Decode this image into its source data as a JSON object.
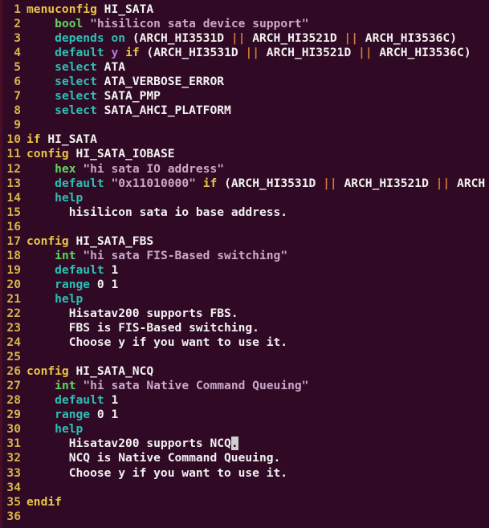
{
  "terminal": {
    "title": "Kconfig editor",
    "background_color": "#300a24",
    "gutter_color": "#d7b44a",
    "cursor": {
      "line": 31,
      "column": 27,
      "char": "."
    }
  },
  "colors": {
    "keyword": "#e8c547",
    "type": "#5fd75f",
    "attribute": "#2bbfb5",
    "string": "#c9a8c9",
    "plain": "#f2f2f2",
    "operator": "#d07b3a",
    "boolean": "#b07be0",
    "line_number": "#d7b44a",
    "background": "#300a24"
  },
  "lines": [
    {
      "n": "1",
      "tokens": [
        {
          "t": "key",
          "v": "menuconfig"
        },
        {
          "t": "plain",
          "v": " HI_SATA"
        }
      ]
    },
    {
      "n": "2",
      "tokens": [
        {
          "t": "plain",
          "v": "    "
        },
        {
          "t": "type",
          "v": "bool"
        },
        {
          "t": "plain",
          "v": " "
        },
        {
          "t": "str",
          "v": "\"hisilicon sata device support\""
        }
      ]
    },
    {
      "n": "3",
      "tokens": [
        {
          "t": "plain",
          "v": "    "
        },
        {
          "t": "attr",
          "v": "depends on"
        },
        {
          "t": "plain",
          "v": " (ARCH_HI3531D "
        },
        {
          "t": "op",
          "v": "||"
        },
        {
          "t": "plain",
          "v": " ARCH_HI3521D "
        },
        {
          "t": "op",
          "v": "||"
        },
        {
          "t": "plain",
          "v": " ARCH_HI3536C)"
        }
      ]
    },
    {
      "n": "4",
      "tokens": [
        {
          "t": "plain",
          "v": "    "
        },
        {
          "t": "attr",
          "v": "default"
        },
        {
          "t": "plain",
          "v": " "
        },
        {
          "t": "bool",
          "v": "y"
        },
        {
          "t": "plain",
          "v": " "
        },
        {
          "t": "key",
          "v": "if"
        },
        {
          "t": "plain",
          "v": " (ARCH_HI3531D "
        },
        {
          "t": "op",
          "v": "||"
        },
        {
          "t": "plain",
          "v": " ARCH_HI3521D "
        },
        {
          "t": "op",
          "v": "||"
        },
        {
          "t": "plain",
          "v": " ARCH_HI3536C)"
        }
      ]
    },
    {
      "n": "5",
      "tokens": [
        {
          "t": "plain",
          "v": "    "
        },
        {
          "t": "attr",
          "v": "select"
        },
        {
          "t": "plain",
          "v": " ATA"
        }
      ]
    },
    {
      "n": "6",
      "tokens": [
        {
          "t": "plain",
          "v": "    "
        },
        {
          "t": "attr",
          "v": "select"
        },
        {
          "t": "plain",
          "v": " ATA_VERBOSE_ERROR"
        }
      ]
    },
    {
      "n": "7",
      "tokens": [
        {
          "t": "plain",
          "v": "    "
        },
        {
          "t": "attr",
          "v": "select"
        },
        {
          "t": "plain",
          "v": " SATA_PMP"
        }
      ]
    },
    {
      "n": "8",
      "tokens": [
        {
          "t": "plain",
          "v": "    "
        },
        {
          "t": "attr",
          "v": "select"
        },
        {
          "t": "plain",
          "v": " SATA_AHCI_PLATFORM"
        }
      ]
    },
    {
      "n": "9",
      "tokens": []
    },
    {
      "n": "10",
      "tokens": [
        {
          "t": "key",
          "v": "if"
        },
        {
          "t": "plain",
          "v": " HI_SATA"
        }
      ]
    },
    {
      "n": "11",
      "tokens": [
        {
          "t": "key",
          "v": "config"
        },
        {
          "t": "plain",
          "v": " HI_SATA_IOBASE"
        }
      ]
    },
    {
      "n": "12",
      "tokens": [
        {
          "t": "plain",
          "v": "    "
        },
        {
          "t": "type",
          "v": "hex"
        },
        {
          "t": "plain",
          "v": " "
        },
        {
          "t": "str",
          "v": "\"hi sata IO address\""
        }
      ]
    },
    {
      "n": "13",
      "tokens": [
        {
          "t": "plain",
          "v": "    "
        },
        {
          "t": "attr",
          "v": "default"
        },
        {
          "t": "plain",
          "v": " "
        },
        {
          "t": "str",
          "v": "\"0x11010000\""
        },
        {
          "t": "plain",
          "v": " "
        },
        {
          "t": "key",
          "v": "if"
        },
        {
          "t": "plain",
          "v": " (ARCH_HI3531D "
        },
        {
          "t": "op",
          "v": "||"
        },
        {
          "t": "plain",
          "v": " ARCH_HI3521D "
        },
        {
          "t": "op",
          "v": "||"
        },
        {
          "t": "plain",
          "v": " ARCH"
        }
      ]
    },
    {
      "n": "14",
      "tokens": [
        {
          "t": "plain",
          "v": "    "
        },
        {
          "t": "attr",
          "v": "help"
        }
      ]
    },
    {
      "n": "15",
      "tokens": [
        {
          "t": "text",
          "v": "      hisilicon sata io base address."
        }
      ]
    },
    {
      "n": "16",
      "tokens": []
    },
    {
      "n": "17",
      "tokens": [
        {
          "t": "key",
          "v": "config"
        },
        {
          "t": "plain",
          "v": " HI_SATA_FBS"
        }
      ]
    },
    {
      "n": "18",
      "tokens": [
        {
          "t": "plain",
          "v": "    "
        },
        {
          "t": "type",
          "v": "int"
        },
        {
          "t": "plain",
          "v": " "
        },
        {
          "t": "str",
          "v": "\"hi sata FIS-Based switching\""
        }
      ]
    },
    {
      "n": "19",
      "tokens": [
        {
          "t": "plain",
          "v": "    "
        },
        {
          "t": "attr",
          "v": "default"
        },
        {
          "t": "plain",
          "v": " 1"
        }
      ]
    },
    {
      "n": "20",
      "tokens": [
        {
          "t": "plain",
          "v": "    "
        },
        {
          "t": "attr",
          "v": "range"
        },
        {
          "t": "plain",
          "v": " 0 1"
        }
      ]
    },
    {
      "n": "21",
      "tokens": [
        {
          "t": "plain",
          "v": "    "
        },
        {
          "t": "attr",
          "v": "help"
        }
      ]
    },
    {
      "n": "22",
      "tokens": [
        {
          "t": "text",
          "v": "      Hisatav200 supports FBS."
        }
      ]
    },
    {
      "n": "23",
      "tokens": [
        {
          "t": "text",
          "v": "      FBS is FIS-Based switching."
        }
      ]
    },
    {
      "n": "24",
      "tokens": [
        {
          "t": "text",
          "v": "      Choose y if you want to use it."
        }
      ]
    },
    {
      "n": "25",
      "tokens": []
    },
    {
      "n": "26",
      "tokens": [
        {
          "t": "key",
          "v": "config"
        },
        {
          "t": "plain",
          "v": " HI_SATA_NCQ"
        }
      ]
    },
    {
      "n": "27",
      "tokens": [
        {
          "t": "plain",
          "v": "    "
        },
        {
          "t": "type",
          "v": "int"
        },
        {
          "t": "plain",
          "v": " "
        },
        {
          "t": "str",
          "v": "\"hi sata Native Command Queuing\""
        }
      ]
    },
    {
      "n": "28",
      "tokens": [
        {
          "t": "plain",
          "v": "    "
        },
        {
          "t": "attr",
          "v": "default"
        },
        {
          "t": "plain",
          "v": " 1"
        }
      ]
    },
    {
      "n": "29",
      "tokens": [
        {
          "t": "plain",
          "v": "    "
        },
        {
          "t": "attr",
          "v": "range"
        },
        {
          "t": "plain",
          "v": " 0 1"
        }
      ]
    },
    {
      "n": "30",
      "tokens": [
        {
          "t": "plain",
          "v": "    "
        },
        {
          "t": "attr",
          "v": "help"
        }
      ]
    },
    {
      "n": "31",
      "tokens": [
        {
          "t": "text",
          "v": "      Hisatav200 supports NCQ"
        },
        {
          "t": "cursor",
          "v": "."
        }
      ]
    },
    {
      "n": "32",
      "tokens": [
        {
          "t": "text",
          "v": "      NCQ is Native Command Queuing."
        }
      ]
    },
    {
      "n": "33",
      "tokens": [
        {
          "t": "text",
          "v": "      Choose y if you want to use it."
        }
      ]
    },
    {
      "n": "34",
      "tokens": []
    },
    {
      "n": "35",
      "tokens": [
        {
          "t": "key",
          "v": "endif"
        }
      ]
    },
    {
      "n": "36",
      "tokens": []
    }
  ]
}
